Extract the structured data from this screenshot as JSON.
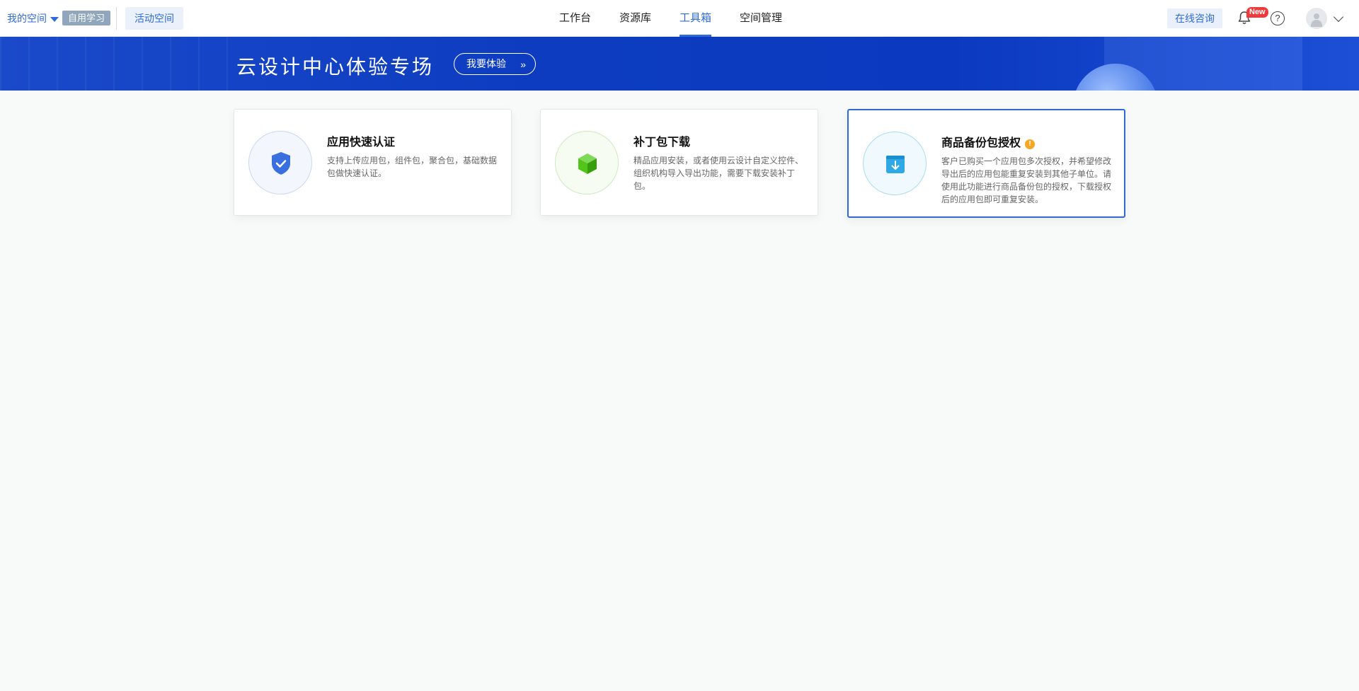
{
  "header": {
    "space_label": "我的空间",
    "space_tag": "自用学习",
    "activity_button": "活动空间",
    "nav": [
      {
        "label": "工作台",
        "active": false
      },
      {
        "label": "资源库",
        "active": false
      },
      {
        "label": "工具箱",
        "active": true
      },
      {
        "label": "空间管理",
        "active": false
      }
    ],
    "consult_button": "在线咨询",
    "notification_badge": "New",
    "help_glyph": "?"
  },
  "banner": {
    "title": "云设计中心体验专场",
    "button_label": "我要体验",
    "button_chevron": "»"
  },
  "cards": [
    {
      "title": "应用快速认证",
      "description": "支持上传应用包，组件包，聚合包，基础数据包做快速认证。",
      "icon": "shield-check-icon",
      "accent": "#3a6fe0",
      "selected": false
    },
    {
      "title": "补丁包下载",
      "description": "精品应用安装，或者使用云设计自定义控件、组织机构导入导出功能，需要下载安装补丁包。",
      "icon": "cube-icon",
      "accent": "#52c41a",
      "selected": false
    },
    {
      "title": "商品备份包授权",
      "warning_glyph": "!",
      "description": "客户已购买一个应用包多次授权，并希望修改导出后的应用包能重复安装到其他子单位。请使用此功能进行商品备份包的授权，下载授权后的应用包即可重复安装。",
      "icon": "box-download-icon",
      "accent": "#2fa8e6",
      "selected": true
    }
  ]
}
